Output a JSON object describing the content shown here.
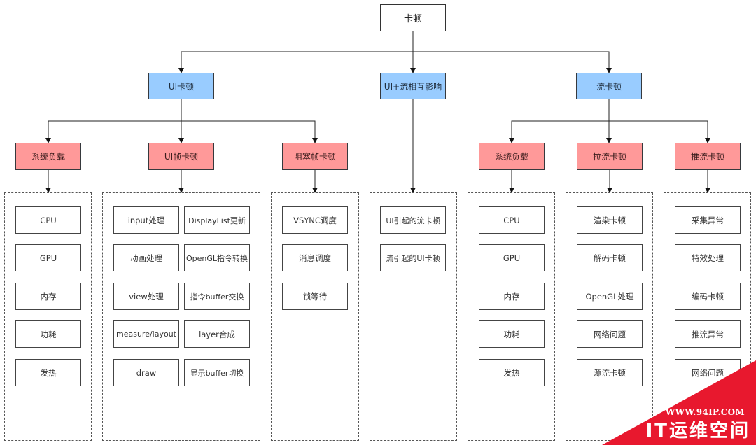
{
  "root": {
    "label": "卡顿"
  },
  "level1": [
    {
      "label": "UI卡顿",
      "color": "#99ccff"
    },
    {
      "label": "UI+流相互影响",
      "color": "#99ccff"
    },
    {
      "label": "流卡顿",
      "color": "#99ccff"
    }
  ],
  "level2": [
    {
      "label": "系统负载",
      "color": "#ff9999"
    },
    {
      "label": "UI帧卡顿",
      "color": "#ff9999"
    },
    {
      "label": "阻塞帧卡顿",
      "color": "#ff9999"
    },
    {
      "label": "系统负载",
      "color": "#ff9999"
    },
    {
      "label": "拉流卡顿",
      "color": "#ff9999"
    },
    {
      "label": "推流卡顿",
      "color": "#ff9999"
    }
  ],
  "groups": {
    "ui_system_load": [
      "CPU",
      "GPU",
      "内存",
      "功耗",
      "发热"
    ],
    "ui_frame": {
      "left": [
        "input处理",
        "动画处理",
        "view处理",
        "measure/layout",
        "draw"
      ],
      "right": [
        "DisplayList更新",
        "OpenGL指令转换",
        "指令buffer交换",
        "layer合成",
        "显示buffer切换"
      ]
    },
    "blocking_frame": [
      "VSYNC调度",
      "消息调度",
      "锁等待"
    ],
    "interaction": [
      "UI引起的流卡顿",
      "流引起的UI卡顿"
    ],
    "stream_system_load": [
      "CPU",
      "GPU",
      "内存",
      "功耗",
      "发热"
    ],
    "pull_stream": [
      "渲染卡顿",
      "解码卡顿",
      "OpenGL处理",
      "网络问题",
      "源流卡顿"
    ],
    "push_stream": [
      "采集异常",
      "特效处理",
      "编码卡顿",
      "推流异常",
      "网络问题",
      ""
    ]
  },
  "watermark": {
    "url": "WWW.94IP.COM",
    "name": "IT运维空间",
    "color": "#e8182e"
  }
}
